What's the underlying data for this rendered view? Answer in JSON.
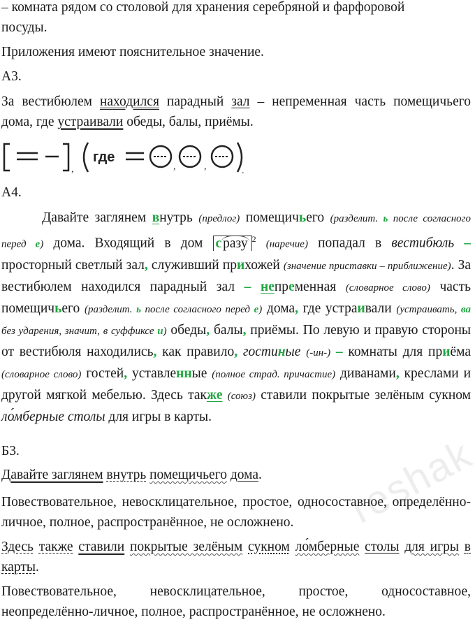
{
  "intro": {
    "l1": "– комната рядом со столовой для хранения серебряной и фарфоровой",
    "l2": "посуды.",
    "l3": "Приложения имеют пояснительное значение."
  },
  "a3": {
    "heading": "А3.",
    "s": [
      "За вестибюлем ",
      "находился",
      " парадный ",
      "зал",
      " – непременная часть помещичьего дома, где ",
      "устраивали",
      " обеды, балы, приёмы."
    ],
    "scheme": {
      "where": "где",
      "dash": "—",
      "eq": "="
    }
  },
  "a4": {
    "heading": "А4.",
    "p": [
      "Давайте заглянем ",
      "в",
      "нутрь ",
      "(предлог)",
      " помещич",
      "ь",
      "его ",
      "(разделит. ",
      "ь",
      " после согласного перед ",
      "е",
      ")",
      " дома. Входящий в дом ",
      "с",
      "разу",
      "2",
      " ",
      "(наречие)",
      " попадал в ",
      "вестибюль",
      " – ",
      "просторный светлый зал",
      ",",
      " служивший пр",
      "и",
      "хожей ",
      "(значение приставки – приближение)",
      ". За вестибюлем находился парадный зал ",
      "–",
      " ",
      "не",
      "пр",
      "е",
      "менная ",
      "(словарное слово)",
      " часть помещич",
      "ь",
      "его ",
      "(разделит. ",
      "ь",
      " после согласного перед ",
      "е",
      ")",
      " дома",
      ",",
      " где устра",
      "и",
      "вали ",
      "(устраивать",
      ", ",
      "ва",
      " без ударения, значит, в суффиксе ",
      "и",
      ")",
      " обеды",
      ",",
      " балы",
      ",",
      " приёмы. По левую и правую стороны от вестибюля находились",
      ",",
      " как правило",
      ",",
      " ",
      "гости",
      "н",
      "ые",
      " ",
      "(-ин-)",
      " ",
      "–",
      " комнаты для пр",
      "и",
      "ёма ",
      "(словарное слово)",
      " гостей",
      ",",
      " уставле",
      "нн",
      "ые ",
      "(полное страд. причастие)",
      " диванами",
      ",",
      " креслами и другой мягкой мебелью. Здесь так",
      "же",
      " ",
      "(союз)",
      " ставили покрытые зелёным сукном ",
      "ло́мберные столы",
      " для игры в карты."
    ]
  },
  "b3": {
    "heading": "Б3.",
    "s1": [
      "Давайте заглянем",
      " ",
      "внутрь",
      " ",
      "помещичьего",
      " ",
      "дома",
      "."
    ],
    "d1": "Повествовательное, невосклицательное, простое, односоставное, определённо-личное, полное, распространённое, не осложнено.",
    "s2": [
      "Здесь",
      " ",
      "также",
      " ",
      "ставили",
      " ",
      "покрытые зелёным",
      " ",
      "сукном",
      " ",
      "ло́мберные",
      " ",
      "столы",
      " ",
      "для игры",
      " ",
      "в карты",
      "."
    ],
    "d2": "Повествовательное, невосклицательное, простое, односоставное, неопределённо-личное, полное, распространённое, не осложнено."
  },
  "watermark": "reshak.ru",
  "colors": {
    "accent": "#21a540",
    "text": "#1a1a1a"
  }
}
